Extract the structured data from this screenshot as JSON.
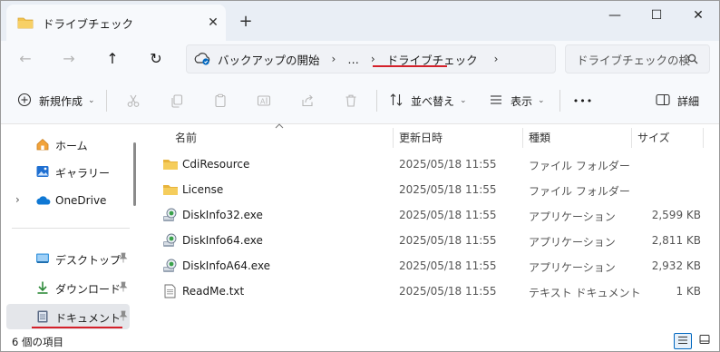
{
  "tab": {
    "title": "ドライブチェック",
    "close": "✕"
  },
  "new_tab": "+",
  "window_controls": {
    "minimize": "—",
    "maximize": "☐",
    "close": "✕"
  },
  "nav": {
    "back": "←",
    "forward": "→",
    "up": "↑",
    "refresh": "↻"
  },
  "address": {
    "crumbs": [
      "バックアップの開始",
      "…",
      "ドライブチェック"
    ],
    "separator": "›",
    "more": "…"
  },
  "search": {
    "placeholder": "ドライブチェックの検"
  },
  "toolbar": {
    "new_label": "新規作成",
    "sort_label": "並べ替え",
    "view_label": "表示",
    "more": "•••",
    "details_label": "詳細"
  },
  "sidebar": {
    "items": [
      {
        "label": "ホーム",
        "icon": "home-icon"
      },
      {
        "label": "ギャラリー",
        "icon": "gallery-icon"
      },
      {
        "label": "OneDrive",
        "icon": "cloud-icon"
      },
      {
        "label": "デスクトップ",
        "icon": "desktop-icon",
        "pinned": true
      },
      {
        "label": "ダウンロード",
        "icon": "download-icon",
        "pinned": true
      },
      {
        "label": "ドキュメント",
        "icon": "document-icon",
        "pinned": true
      }
    ],
    "pin_glyph": "📌"
  },
  "columns": {
    "name": "名前",
    "date": "更新日時",
    "type": "種類",
    "size": "サイズ"
  },
  "files": [
    {
      "name": "CdiResource",
      "date": "2025/05/18  11:55",
      "type": "ファイル フォルダー",
      "size": "",
      "icon": "folder-icon"
    },
    {
      "name": "License",
      "date": "2025/05/18  11:55",
      "type": "ファイル フォルダー",
      "size": "",
      "icon": "folder-icon"
    },
    {
      "name": "DiskInfo32.exe",
      "date": "2025/05/18  11:55",
      "type": "アプリケーション",
      "size": "2,599 KB",
      "icon": "app-icon"
    },
    {
      "name": "DiskInfo64.exe",
      "date": "2025/05/18  11:55",
      "type": "アプリケーション",
      "size": "2,811 KB",
      "icon": "app-icon"
    },
    {
      "name": "DiskInfoA64.exe",
      "date": "2025/05/18  11:55",
      "type": "アプリケーション",
      "size": "2,932 KB",
      "icon": "app-icon"
    },
    {
      "name": "ReadMe.txt",
      "date": "2025/05/18  11:55",
      "type": "テキスト ドキュメント",
      "size": "1 KB",
      "icon": "text-file-icon"
    }
  ],
  "status": {
    "item_count": "6 個の項目"
  },
  "colors": {
    "accent": "#0067c0",
    "folder": "#f2c34e",
    "highlight": "#d4202a",
    "selected_bg": "#e4e6ea"
  }
}
